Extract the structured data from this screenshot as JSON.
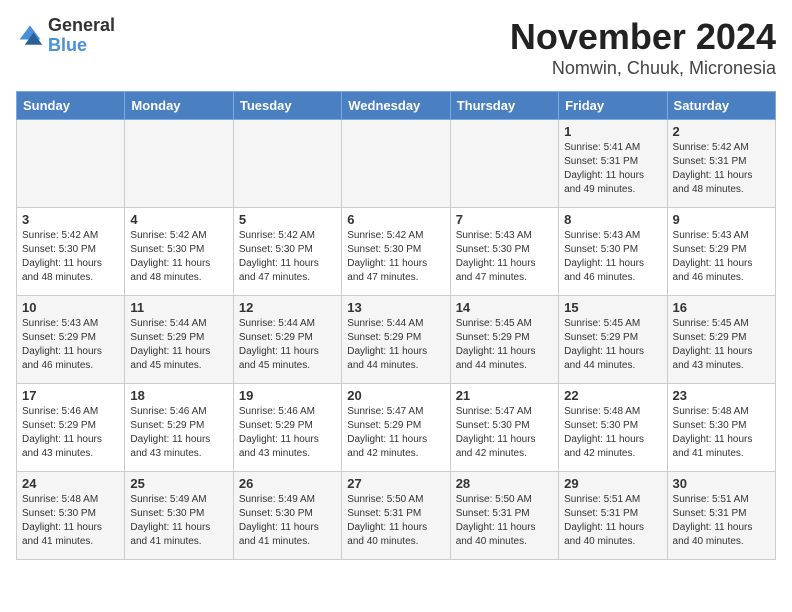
{
  "logo": {
    "general": "General",
    "blue": "Blue"
  },
  "title": "November 2024",
  "location": "Nomwin, Chuuk, Micronesia",
  "days_of_week": [
    "Sunday",
    "Monday",
    "Tuesday",
    "Wednesday",
    "Thursday",
    "Friday",
    "Saturday"
  ],
  "weeks": [
    [
      {
        "day": "",
        "info": ""
      },
      {
        "day": "",
        "info": ""
      },
      {
        "day": "",
        "info": ""
      },
      {
        "day": "",
        "info": ""
      },
      {
        "day": "",
        "info": ""
      },
      {
        "day": "1",
        "info": "Sunrise: 5:41 AM\nSunset: 5:31 PM\nDaylight: 11 hours\nand 49 minutes."
      },
      {
        "day": "2",
        "info": "Sunrise: 5:42 AM\nSunset: 5:31 PM\nDaylight: 11 hours\nand 48 minutes."
      }
    ],
    [
      {
        "day": "3",
        "info": "Sunrise: 5:42 AM\nSunset: 5:30 PM\nDaylight: 11 hours\nand 48 minutes."
      },
      {
        "day": "4",
        "info": "Sunrise: 5:42 AM\nSunset: 5:30 PM\nDaylight: 11 hours\nand 48 minutes."
      },
      {
        "day": "5",
        "info": "Sunrise: 5:42 AM\nSunset: 5:30 PM\nDaylight: 11 hours\nand 47 minutes."
      },
      {
        "day": "6",
        "info": "Sunrise: 5:42 AM\nSunset: 5:30 PM\nDaylight: 11 hours\nand 47 minutes."
      },
      {
        "day": "7",
        "info": "Sunrise: 5:43 AM\nSunset: 5:30 PM\nDaylight: 11 hours\nand 47 minutes."
      },
      {
        "day": "8",
        "info": "Sunrise: 5:43 AM\nSunset: 5:30 PM\nDaylight: 11 hours\nand 46 minutes."
      },
      {
        "day": "9",
        "info": "Sunrise: 5:43 AM\nSunset: 5:29 PM\nDaylight: 11 hours\nand 46 minutes."
      }
    ],
    [
      {
        "day": "10",
        "info": "Sunrise: 5:43 AM\nSunset: 5:29 PM\nDaylight: 11 hours\nand 46 minutes."
      },
      {
        "day": "11",
        "info": "Sunrise: 5:44 AM\nSunset: 5:29 PM\nDaylight: 11 hours\nand 45 minutes."
      },
      {
        "day": "12",
        "info": "Sunrise: 5:44 AM\nSunset: 5:29 PM\nDaylight: 11 hours\nand 45 minutes."
      },
      {
        "day": "13",
        "info": "Sunrise: 5:44 AM\nSunset: 5:29 PM\nDaylight: 11 hours\nand 44 minutes."
      },
      {
        "day": "14",
        "info": "Sunrise: 5:45 AM\nSunset: 5:29 PM\nDaylight: 11 hours\nand 44 minutes."
      },
      {
        "day": "15",
        "info": "Sunrise: 5:45 AM\nSunset: 5:29 PM\nDaylight: 11 hours\nand 44 minutes."
      },
      {
        "day": "16",
        "info": "Sunrise: 5:45 AM\nSunset: 5:29 PM\nDaylight: 11 hours\nand 43 minutes."
      }
    ],
    [
      {
        "day": "17",
        "info": "Sunrise: 5:46 AM\nSunset: 5:29 PM\nDaylight: 11 hours\nand 43 minutes."
      },
      {
        "day": "18",
        "info": "Sunrise: 5:46 AM\nSunset: 5:29 PM\nDaylight: 11 hours\nand 43 minutes."
      },
      {
        "day": "19",
        "info": "Sunrise: 5:46 AM\nSunset: 5:29 PM\nDaylight: 11 hours\nand 43 minutes."
      },
      {
        "day": "20",
        "info": "Sunrise: 5:47 AM\nSunset: 5:29 PM\nDaylight: 11 hours\nand 42 minutes."
      },
      {
        "day": "21",
        "info": "Sunrise: 5:47 AM\nSunset: 5:30 PM\nDaylight: 11 hours\nand 42 minutes."
      },
      {
        "day": "22",
        "info": "Sunrise: 5:48 AM\nSunset: 5:30 PM\nDaylight: 11 hours\nand 42 minutes."
      },
      {
        "day": "23",
        "info": "Sunrise: 5:48 AM\nSunset: 5:30 PM\nDaylight: 11 hours\nand 41 minutes."
      }
    ],
    [
      {
        "day": "24",
        "info": "Sunrise: 5:48 AM\nSunset: 5:30 PM\nDaylight: 11 hours\nand 41 minutes."
      },
      {
        "day": "25",
        "info": "Sunrise: 5:49 AM\nSunset: 5:30 PM\nDaylight: 11 hours\nand 41 minutes."
      },
      {
        "day": "26",
        "info": "Sunrise: 5:49 AM\nSunset: 5:30 PM\nDaylight: 11 hours\nand 41 minutes."
      },
      {
        "day": "27",
        "info": "Sunrise: 5:50 AM\nSunset: 5:31 PM\nDaylight: 11 hours\nand 40 minutes."
      },
      {
        "day": "28",
        "info": "Sunrise: 5:50 AM\nSunset: 5:31 PM\nDaylight: 11 hours\nand 40 minutes."
      },
      {
        "day": "29",
        "info": "Sunrise: 5:51 AM\nSunset: 5:31 PM\nDaylight: 11 hours\nand 40 minutes."
      },
      {
        "day": "30",
        "info": "Sunrise: 5:51 AM\nSunset: 5:31 PM\nDaylight: 11 hours\nand 40 minutes."
      }
    ]
  ]
}
